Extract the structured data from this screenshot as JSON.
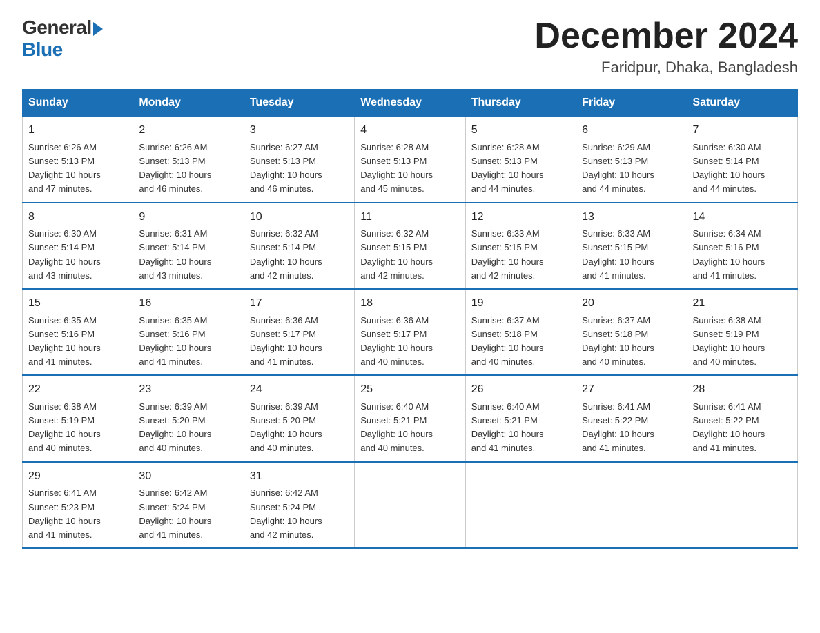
{
  "logo": {
    "general": "General",
    "blue": "Blue"
  },
  "title": "December 2024",
  "location": "Faridpur, Dhaka, Bangladesh",
  "days_of_week": [
    "Sunday",
    "Monday",
    "Tuesday",
    "Wednesday",
    "Thursday",
    "Friday",
    "Saturday"
  ],
  "weeks": [
    [
      {
        "day": "1",
        "sunrise": "6:26 AM",
        "sunset": "5:13 PM",
        "daylight": "10 hours and 47 minutes."
      },
      {
        "day": "2",
        "sunrise": "6:26 AM",
        "sunset": "5:13 PM",
        "daylight": "10 hours and 46 minutes."
      },
      {
        "day": "3",
        "sunrise": "6:27 AM",
        "sunset": "5:13 PM",
        "daylight": "10 hours and 46 minutes."
      },
      {
        "day": "4",
        "sunrise": "6:28 AM",
        "sunset": "5:13 PM",
        "daylight": "10 hours and 45 minutes."
      },
      {
        "day": "5",
        "sunrise": "6:28 AM",
        "sunset": "5:13 PM",
        "daylight": "10 hours and 44 minutes."
      },
      {
        "day": "6",
        "sunrise": "6:29 AM",
        "sunset": "5:13 PM",
        "daylight": "10 hours and 44 minutes."
      },
      {
        "day": "7",
        "sunrise": "6:30 AM",
        "sunset": "5:14 PM",
        "daylight": "10 hours and 44 minutes."
      }
    ],
    [
      {
        "day": "8",
        "sunrise": "6:30 AM",
        "sunset": "5:14 PM",
        "daylight": "10 hours and 43 minutes."
      },
      {
        "day": "9",
        "sunrise": "6:31 AM",
        "sunset": "5:14 PM",
        "daylight": "10 hours and 43 minutes."
      },
      {
        "day": "10",
        "sunrise": "6:32 AM",
        "sunset": "5:14 PM",
        "daylight": "10 hours and 42 minutes."
      },
      {
        "day": "11",
        "sunrise": "6:32 AM",
        "sunset": "5:15 PM",
        "daylight": "10 hours and 42 minutes."
      },
      {
        "day": "12",
        "sunrise": "6:33 AM",
        "sunset": "5:15 PM",
        "daylight": "10 hours and 42 minutes."
      },
      {
        "day": "13",
        "sunrise": "6:33 AM",
        "sunset": "5:15 PM",
        "daylight": "10 hours and 41 minutes."
      },
      {
        "day": "14",
        "sunrise": "6:34 AM",
        "sunset": "5:16 PM",
        "daylight": "10 hours and 41 minutes."
      }
    ],
    [
      {
        "day": "15",
        "sunrise": "6:35 AM",
        "sunset": "5:16 PM",
        "daylight": "10 hours and 41 minutes."
      },
      {
        "day": "16",
        "sunrise": "6:35 AM",
        "sunset": "5:16 PM",
        "daylight": "10 hours and 41 minutes."
      },
      {
        "day": "17",
        "sunrise": "6:36 AM",
        "sunset": "5:17 PM",
        "daylight": "10 hours and 41 minutes."
      },
      {
        "day": "18",
        "sunrise": "6:36 AM",
        "sunset": "5:17 PM",
        "daylight": "10 hours and 40 minutes."
      },
      {
        "day": "19",
        "sunrise": "6:37 AM",
        "sunset": "5:18 PM",
        "daylight": "10 hours and 40 minutes."
      },
      {
        "day": "20",
        "sunrise": "6:37 AM",
        "sunset": "5:18 PM",
        "daylight": "10 hours and 40 minutes."
      },
      {
        "day": "21",
        "sunrise": "6:38 AM",
        "sunset": "5:19 PM",
        "daylight": "10 hours and 40 minutes."
      }
    ],
    [
      {
        "day": "22",
        "sunrise": "6:38 AM",
        "sunset": "5:19 PM",
        "daylight": "10 hours and 40 minutes."
      },
      {
        "day": "23",
        "sunrise": "6:39 AM",
        "sunset": "5:20 PM",
        "daylight": "10 hours and 40 minutes."
      },
      {
        "day": "24",
        "sunrise": "6:39 AM",
        "sunset": "5:20 PM",
        "daylight": "10 hours and 40 minutes."
      },
      {
        "day": "25",
        "sunrise": "6:40 AM",
        "sunset": "5:21 PM",
        "daylight": "10 hours and 40 minutes."
      },
      {
        "day": "26",
        "sunrise": "6:40 AM",
        "sunset": "5:21 PM",
        "daylight": "10 hours and 41 minutes."
      },
      {
        "day": "27",
        "sunrise": "6:41 AM",
        "sunset": "5:22 PM",
        "daylight": "10 hours and 41 minutes."
      },
      {
        "day": "28",
        "sunrise": "6:41 AM",
        "sunset": "5:22 PM",
        "daylight": "10 hours and 41 minutes."
      }
    ],
    [
      {
        "day": "29",
        "sunrise": "6:41 AM",
        "sunset": "5:23 PM",
        "daylight": "10 hours and 41 minutes."
      },
      {
        "day": "30",
        "sunrise": "6:42 AM",
        "sunset": "5:24 PM",
        "daylight": "10 hours and 41 minutes."
      },
      {
        "day": "31",
        "sunrise": "6:42 AM",
        "sunset": "5:24 PM",
        "daylight": "10 hours and 42 minutes."
      },
      null,
      null,
      null,
      null
    ]
  ],
  "labels": {
    "sunrise": "Sunrise:",
    "sunset": "Sunset:",
    "daylight": "Daylight:"
  }
}
